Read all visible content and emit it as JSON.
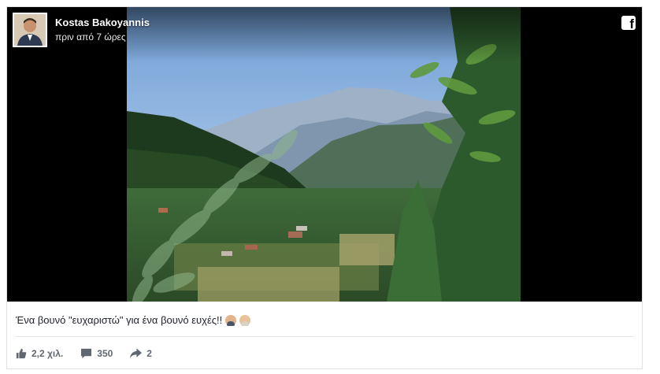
{
  "post": {
    "author": "Kostas Bakoyannis",
    "time": "πριν από 7 ώρες",
    "caption": "Ένα βουνό \"ευχαριστώ\" για ένα βουνό ευχές!!",
    "caption_emojis": [
      "man-in-suit-emoji",
      "man-emoji"
    ]
  },
  "stats": {
    "likes": "2,2 χιλ.",
    "comments": "350",
    "shares": "2"
  },
  "colors": {
    "footer_text": "#606770",
    "caption_text": "#1d2129",
    "media_background": "#000000"
  },
  "icons": {
    "brand": "facebook-icon",
    "like": "thumbs-up-icon",
    "comment": "comment-icon",
    "share": "share-icon"
  }
}
